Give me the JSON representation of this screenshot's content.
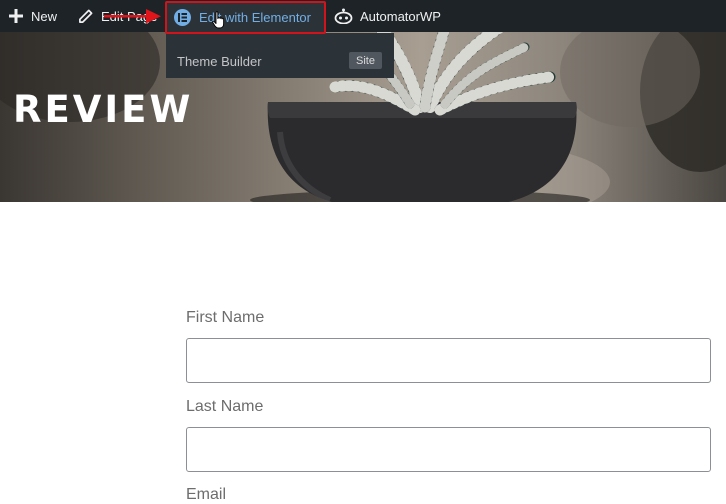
{
  "admin_bar": {
    "new_label": "New",
    "edit_page_label": "Edit Page",
    "elementor_label": "Edit with Elementor",
    "automator_label": "AutomatorWP",
    "icons": {
      "new": "plus-icon",
      "edit": "pencil-icon",
      "elementor": "elementor-icon",
      "automator": "robot-icon"
    },
    "highlight_color": "#d1141b",
    "bar_color": "#1d2327",
    "link_color": "#72aee6"
  },
  "dropdown": {
    "item_label": "Theme Builder",
    "tag": "Site"
  },
  "hero": {
    "title": "REVIEW"
  },
  "form": {
    "first_name_label": "First Name",
    "first_name_value": "",
    "last_name_label": "Last Name",
    "last_name_value": "",
    "email_label": "Email"
  }
}
